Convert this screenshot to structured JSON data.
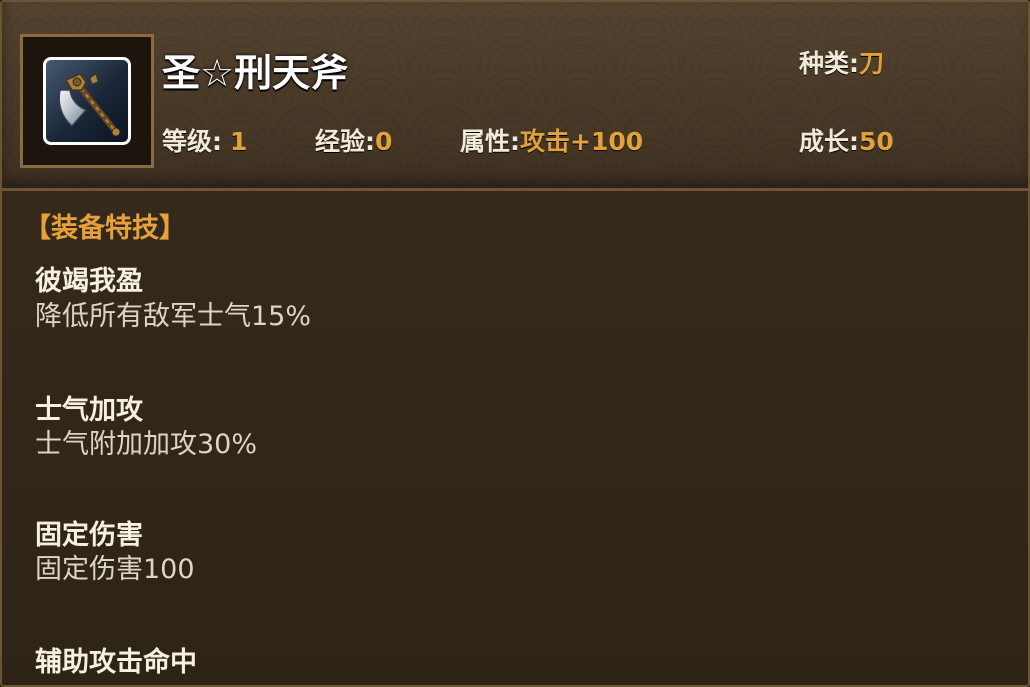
{
  "item": {
    "name": "圣☆刑天斧",
    "icon": "axe-icon",
    "stats": {
      "type_label": "种类:",
      "type_value": "刀",
      "level_label": "等级:",
      "level_value": "1",
      "exp_label": "经验:",
      "exp_value": "0",
      "attr_label": "属性:",
      "attr_value": "攻击+100",
      "growth_label": "成长:",
      "growth_value": "50"
    }
  },
  "skills_section": {
    "title": "【装备特技】",
    "skills": [
      {
        "name": "彼竭我盈",
        "desc": "降低所有敌军士气15%"
      },
      {
        "name": "士气加攻",
        "desc": "士气附加加攻30%"
      },
      {
        "name": "固定伤害",
        "desc": "固定伤害100"
      },
      {
        "name": "辅助攻击命中",
        "desc": ""
      }
    ]
  },
  "colors": {
    "value_gold": "#e1a13b",
    "title_white": "#ffffff",
    "section_orange": "#e6a13a",
    "panel_brown": "#2f2417"
  }
}
